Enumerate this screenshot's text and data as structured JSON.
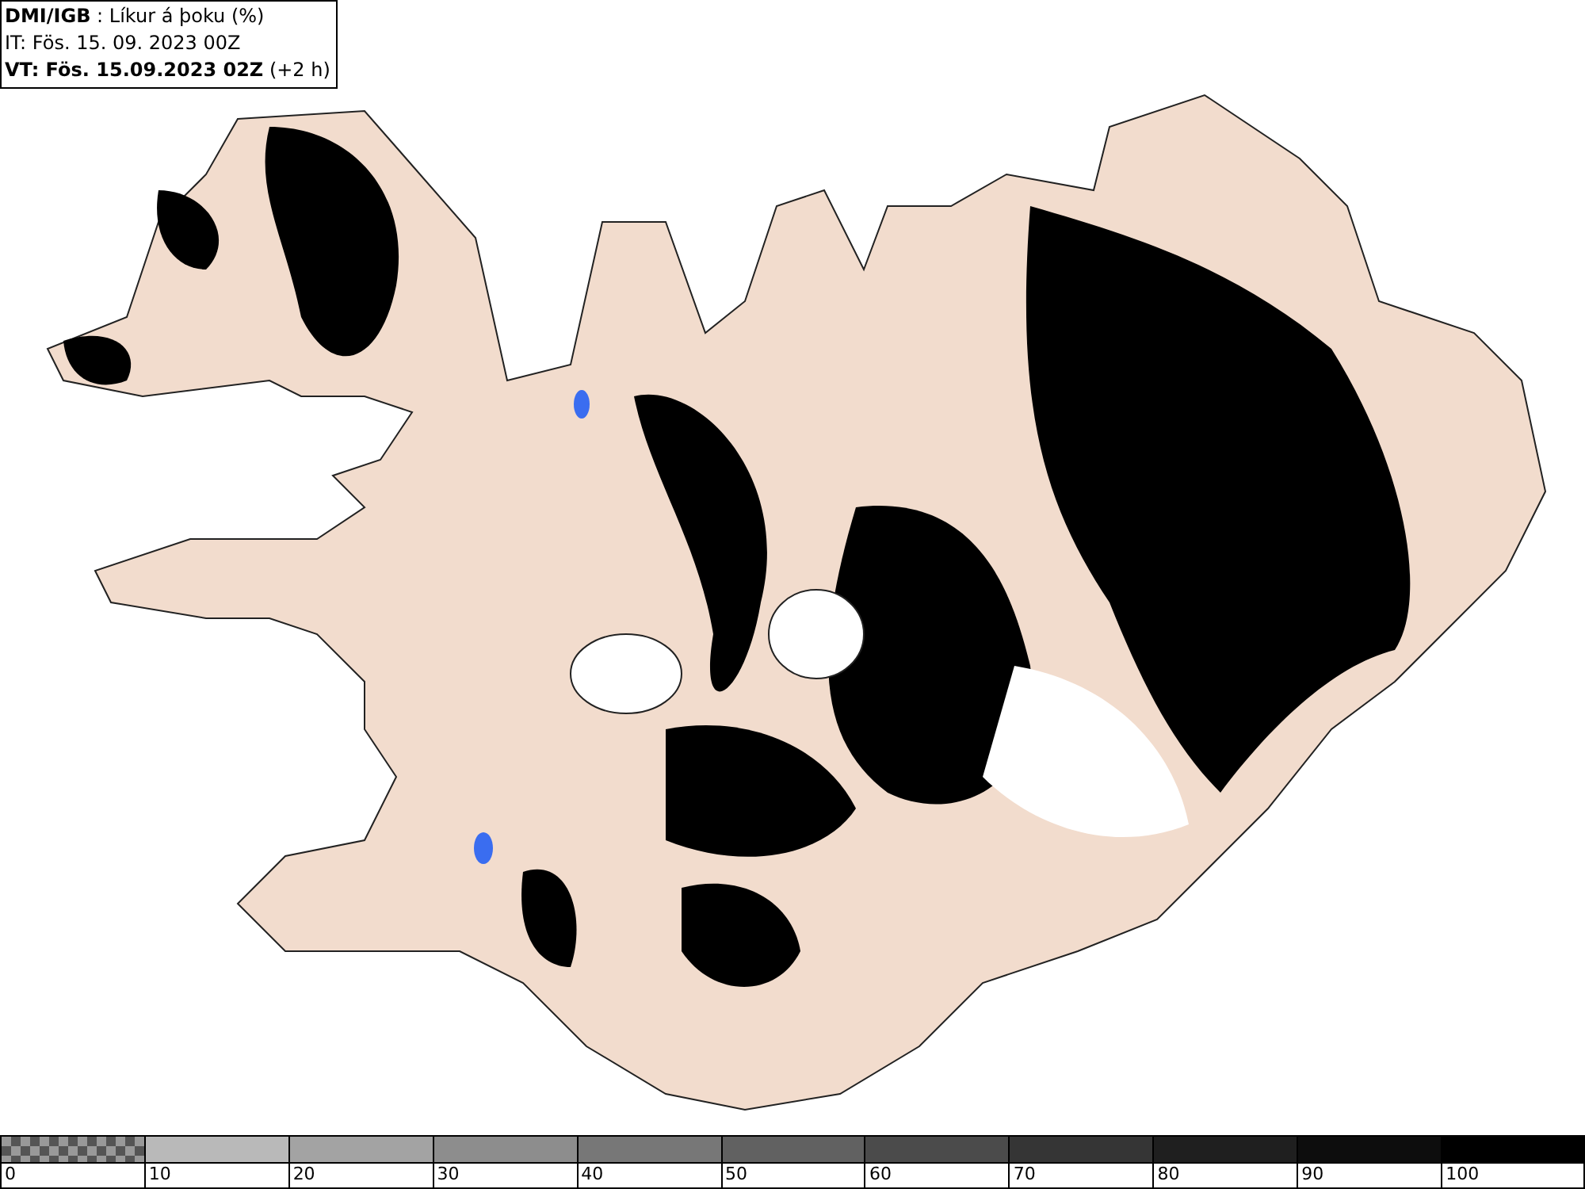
{
  "header": {
    "lines": [
      "**DMI/IGB** : Líkur á þoku (%)",
      "IT: Fös. 15. 09. 2023 00Z",
      "**VT: Fös. 15.09.2023 02Z** (+2 h)"
    ]
  },
  "legend": {
    "segments": [
      {
        "kind": "pattern",
        "label": "0"
      },
      {
        "kind": "solid",
        "color": "#b9b9b9",
        "label": "10"
      },
      {
        "kind": "solid",
        "color": "#a3a3a3",
        "label": "20"
      },
      {
        "kind": "solid",
        "color": "#8d8d8d",
        "label": "30"
      },
      {
        "kind": "solid",
        "color": "#777777",
        "label": "40"
      },
      {
        "kind": "solid",
        "color": "#616161",
        "label": "50"
      },
      {
        "kind": "solid",
        "color": "#4b4b4b",
        "label": "60"
      },
      {
        "kind": "solid",
        "color": "#353535",
        "label": "70"
      },
      {
        "kind": "solid",
        "color": "#1f1f1f",
        "label": "80"
      },
      {
        "kind": "solid",
        "color": "#0d0d0d",
        "label": "90"
      },
      {
        "kind": "solid",
        "color": "#000000",
        "label": "100"
      }
    ]
  }
}
